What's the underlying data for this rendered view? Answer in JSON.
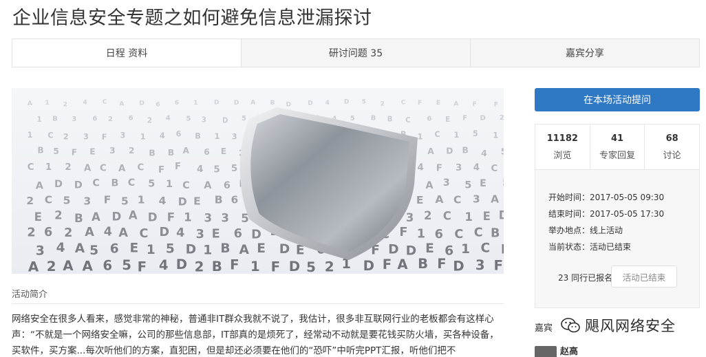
{
  "page_title": "企业信息安全专题之如何避免信息泄漏探讨",
  "tabs": [
    {
      "label": "日程 资料"
    },
    {
      "label": "研讨问题 35"
    },
    {
      "label": "嘉宾分享"
    }
  ],
  "intro": {
    "heading": "活动简介",
    "text": "网络安全在很多人看来，感觉非常的神秘，普通非IT群众我就不说了，我估计，很多非互联网行业的老板都会有这样心声：“不就是一个网络安全嘛，公司的那些信息部，IT部真的是烦死了，经常动不动就是要花钱买防火墙，买各种设备，买软件，买方案...每次听他们的方案，直犯困，但是却还必须要在他们的“恐吓”中听完PPT汇报，听他们把不"
  },
  "sidebar": {
    "ask_button": "在本场活动提问",
    "stats": [
      {
        "value": "11182",
        "label": "浏览"
      },
      {
        "value": "41",
        "label": "专家回复"
      },
      {
        "value": "68",
        "label": "讨论"
      }
    ],
    "info": {
      "start": "开始时间：2017-05-05 09:30",
      "end": "结束时间：2017-05-05 17:30",
      "venue": "举办地点：线上活动",
      "status": "当前状态：活动已结束"
    },
    "join_count": "23 同行已报名",
    "ended_button": "活动已结束",
    "guest_label": "嘉宾",
    "guest_name": "赵高"
  },
  "watermark": {
    "text": "飓风网络安全",
    "icon": "wechat-icon"
  },
  "colors": {
    "accent": "#2f78c4",
    "tab_active_bg": "#ffffff",
    "tab_bg": "#f5f5f5",
    "info_bg": "#f7f7f7"
  },
  "hero_image": {
    "glyphs": [
      "5",
      "A",
      "D",
      "E",
      "B",
      "C",
      "1",
      "2",
      "3",
      "4",
      "F",
      "6"
    ]
  }
}
